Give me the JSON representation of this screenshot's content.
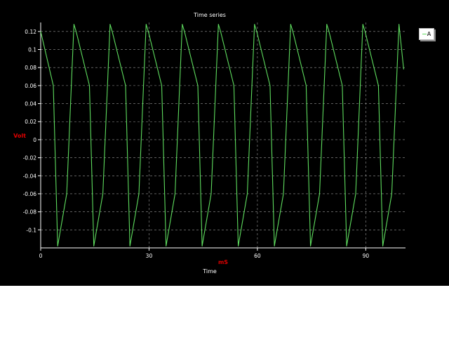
{
  "chart_data": {
    "type": "line",
    "title": "Time series",
    "xlabel": "Time",
    "ylabel": "Volt",
    "x_unit": "mS",
    "xlim": [
      0,
      101
    ],
    "ylim": [
      -0.12,
      0.13
    ],
    "x_ticks": [
      0,
      30,
      60,
      90
    ],
    "y_ticks": [
      0.12,
      0.1,
      0.08,
      0.06,
      0.04,
      0.02,
      0,
      -0.02,
      -0.04,
      -0.06,
      -0.08,
      -0.1
    ],
    "y_tick_labels": [
      "0.12",
      "0.1",
      "0.08",
      "0.06",
      "0.04",
      "0.02",
      "0",
      "-0.02",
      "-0.04",
      "-0.06",
      "-0.08",
      "-0.1"
    ],
    "grid": true,
    "legend_position": "top-right",
    "series": [
      {
        "name": "A",
        "color": "#5edc5e",
        "x": [
          0,
          3.5,
          4.7,
          7.2,
          9.2,
          9.8,
          13.5,
          14.7,
          17.2,
          19.2,
          19.8,
          23.5,
          24.7,
          27.2,
          29.2,
          29.8,
          33.5,
          34.7,
          37.2,
          39.2,
          39.8,
          43.5,
          44.7,
          47.2,
          49.2,
          49.8,
          53.5,
          54.7,
          57.2,
          59.2,
          59.8,
          63.5,
          64.7,
          67.2,
          69.2,
          69.8,
          73.5,
          74.7,
          77.2,
          79.2,
          79.8,
          83.5,
          84.7,
          87.2,
          89.2,
          89.8,
          93.5,
          94.7,
          97.2,
          99.2,
          100.5
        ],
        "y": [
          0.12,
          0.06,
          -0.118,
          -0.06,
          0.128,
          0.12,
          0.06,
          -0.118,
          -0.06,
          0.128,
          0.12,
          0.06,
          -0.118,
          -0.06,
          0.128,
          0.12,
          0.06,
          -0.118,
          -0.06,
          0.128,
          0.12,
          0.06,
          -0.118,
          -0.06,
          0.128,
          0.12,
          0.06,
          -0.118,
          -0.06,
          0.128,
          0.12,
          0.06,
          -0.118,
          -0.06,
          0.128,
          0.12,
          0.06,
          -0.118,
          -0.06,
          0.128,
          0.12,
          0.06,
          -0.118,
          -0.06,
          0.128,
          0.12,
          0.06,
          -0.118,
          -0.06,
          0.128,
          0.078
        ]
      }
    ]
  },
  "colors": {
    "background": "#000000",
    "axis_label": "#e00000",
    "text": "#ffffff",
    "grid": "#9a9a9a"
  }
}
